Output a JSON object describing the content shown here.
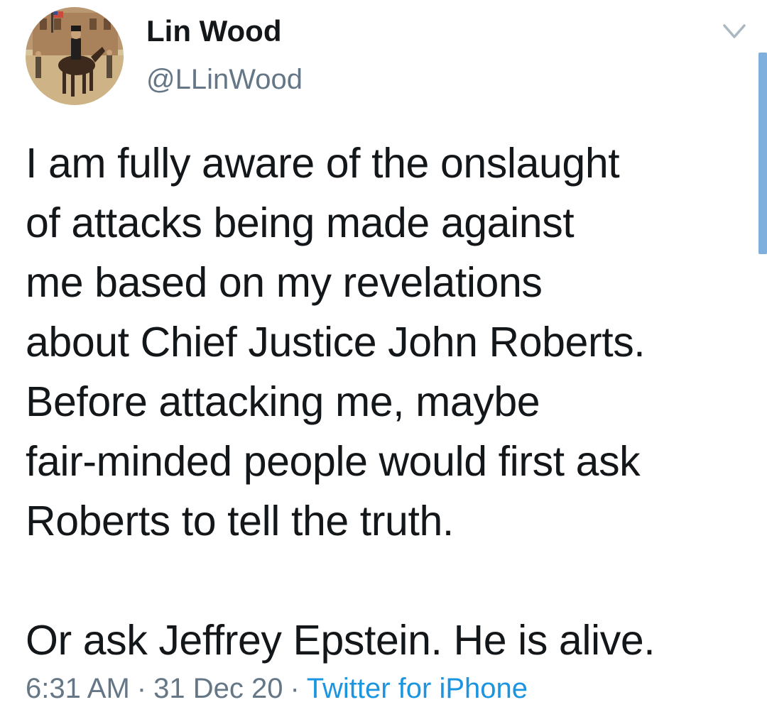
{
  "tweet": {
    "author": {
      "display_name": "Lin Wood",
      "handle": "@LLinWood",
      "avatar_icon": "profile-painting-horse-rider-avatar"
    },
    "text": "I am fully aware of the onslaught\nof attacks being made against\nme based on my revelations\nabout Chief Justice John Roberts.\nBefore attacking me, maybe\nfair-minded people would first ask\nRoberts to tell the truth.\n\nOr ask Jeffrey Epstein. He is alive.",
    "time": "6:31 AM",
    "separator": "·",
    "date": "31 Dec 20",
    "source": "Twitter for iPhone",
    "menu_icon": "chevron-down-icon"
  },
  "colors": {
    "text": "#14171a",
    "secondary": "#657786",
    "link": "#1b95e0",
    "scrollbar": "#7fb0dd"
  }
}
